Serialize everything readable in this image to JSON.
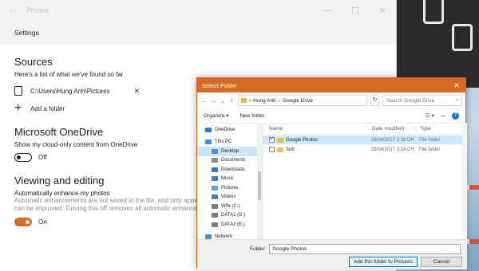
{
  "photos_app": {
    "titlebar": {
      "title": "Photos",
      "back_icon": "back-arrow-icon",
      "minimize": "—",
      "maximize": "☐",
      "close": "✕"
    },
    "header": {
      "title": "Settings"
    },
    "sources": {
      "heading": "Sources",
      "description": "Here's a list of what we've found so far.",
      "folder_path": "C:\\Users\\Hung Anh\\Pictures",
      "remove_symbol": "✕",
      "add_folder_label": "Add a folder"
    },
    "onedrive": {
      "heading": "Microsoft OneDrive",
      "description": "Show my cloud-only content from OneDrive",
      "toggle_state": "Off"
    },
    "viewing": {
      "heading": "Viewing and editing",
      "subheading": "Automatically enhance my photos",
      "note_line1": "Automatic enhancements are not saved in the file, and only appear o",
      "note_line2": "can be improved. Turning this off removes all automatic enhancement",
      "toggle_state": "On"
    },
    "accent_color": "#d46b2c"
  },
  "dialog": {
    "title": "Select Folder",
    "close_symbol": "✕",
    "address": {
      "segment1": "Hung Anh",
      "separator": "›",
      "segment2": "Google Drive"
    },
    "search_placeholder": "Search Google Drive",
    "toolbar": {
      "organize": "Organize ▾",
      "new_folder": "New folder"
    },
    "nav": [
      {
        "label": "OneDrive",
        "icon": "cloud-icon",
        "indent": false,
        "selected": false,
        "gap": false
      },
      {
        "label": "This PC",
        "icon": "computer-icon",
        "indent": false,
        "selected": false,
        "gap": true
      },
      {
        "label": "Desktop",
        "icon": "desktop-icon",
        "indent": true,
        "selected": true,
        "gap": false
      },
      {
        "label": "Documents",
        "icon": "documents-icon",
        "indent": true,
        "selected": false,
        "gap": false
      },
      {
        "label": "Downloads",
        "icon": "downloads-icon",
        "indent": true,
        "selected": false,
        "gap": false
      },
      {
        "label": "Music",
        "icon": "music-icon",
        "indent": true,
        "selected": false,
        "gap": false
      },
      {
        "label": "Pictures",
        "icon": "pictures-icon",
        "indent": true,
        "selected": false,
        "gap": false
      },
      {
        "label": "Videos",
        "icon": "videos-icon",
        "indent": true,
        "selected": false,
        "gap": false
      },
      {
        "label": "WIN (C:)",
        "icon": "drive-icon",
        "indent": true,
        "selected": false,
        "gap": false
      },
      {
        "label": "DATA1 (D:)",
        "icon": "drive-icon",
        "indent": true,
        "selected": false,
        "gap": false
      },
      {
        "label": "DATA2 (E:)",
        "icon": "drive-icon",
        "indent": true,
        "selected": false,
        "gap": false
      },
      {
        "label": "Network",
        "icon": "network-icon",
        "indent": false,
        "selected": false,
        "gap": true
      }
    ],
    "columns": {
      "name": "Name",
      "date": "Date modified",
      "type": "Type"
    },
    "files": [
      {
        "name": "Google Photos",
        "date": "28/04/2017 2:28 CH",
        "type": "File folder",
        "selected": true
      },
      {
        "name": "Sub",
        "date": "28/04/2017 2:24 CH",
        "type": "File folder",
        "selected": false
      }
    ],
    "folder_label": "Folder:",
    "folder_value": "Google Photos",
    "primary_button": "Add this folder to Pictures",
    "cancel_button": "Cancel",
    "title_color": "#d76a22"
  }
}
